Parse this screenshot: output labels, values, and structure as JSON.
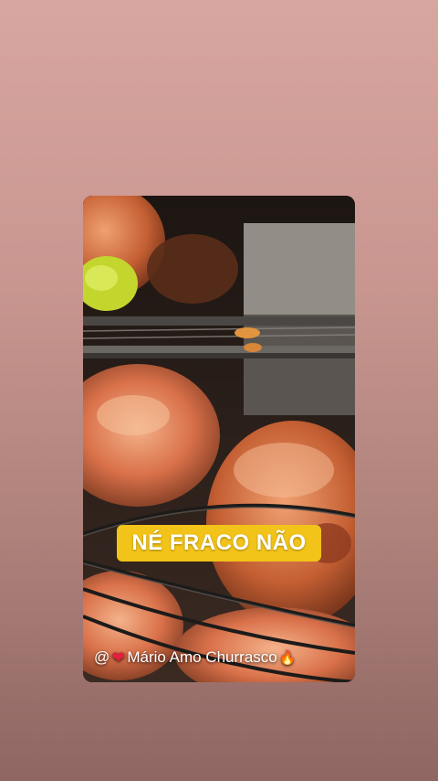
{
  "story": {
    "caption": "NÉ FRACO NÃO",
    "credit_prefix": "@",
    "credit_name": "Mário Amo Churrasco",
    "heart_icon": "❤",
    "fire_icon": "🔥"
  },
  "colors": {
    "caption_bg": "#f2c318",
    "heart": "#e0213b"
  },
  "icons": [
    "heart-icon",
    "fire-icon"
  ]
}
